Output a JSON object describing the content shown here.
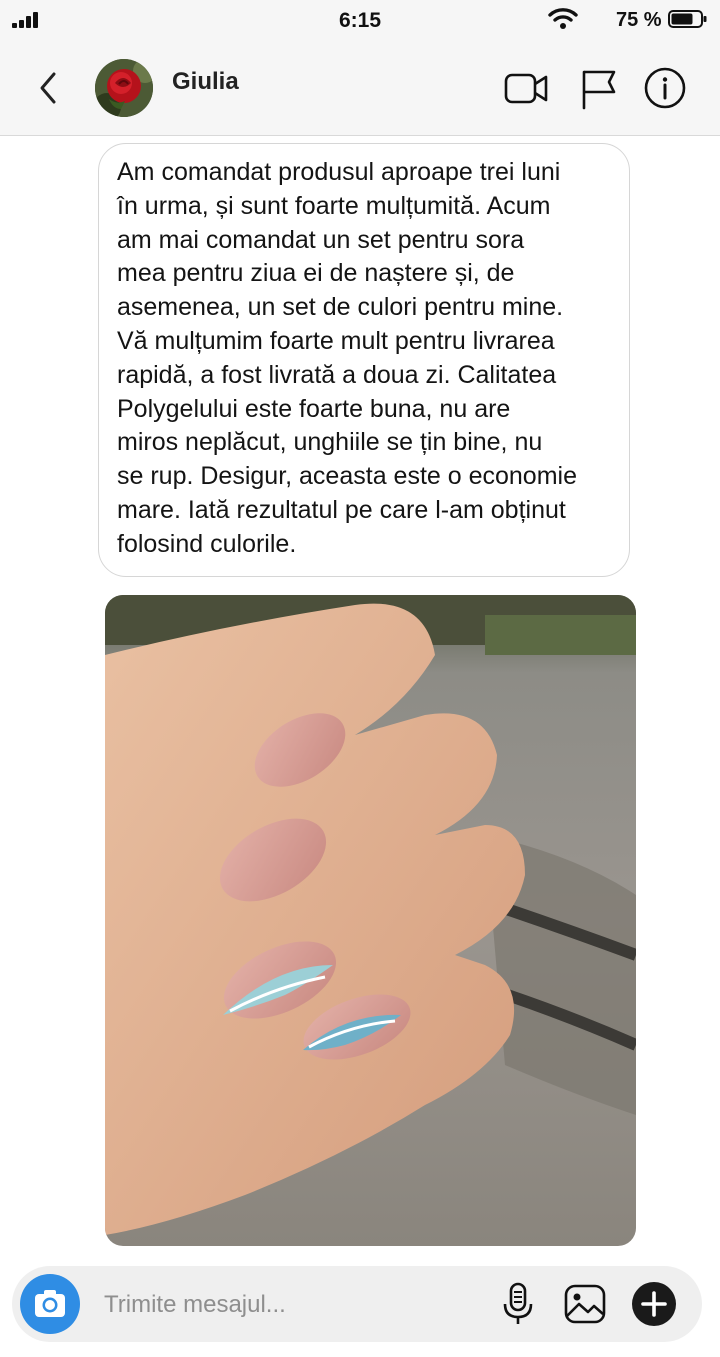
{
  "status_bar": {
    "time": "6:15",
    "battery_percent": "75 %",
    "battery_level": 0.75,
    "signal_bars": 4
  },
  "header": {
    "contact_name": "Giulia",
    "avatar_icon": "red-rose-avatar",
    "icons": [
      "chevron-left-icon",
      "video-call-icon",
      "flag-icon",
      "info-icon"
    ]
  },
  "message": {
    "lines": [
      "Am comandat produsul aproape trei luni",
      "în urma, și sunt foarte mulțumită. Acum",
      "am mai comandat un set pentru sora",
      "mea pentru ziua ei de naștere și, de",
      "asemenea, un set de culori pentru mine.",
      "Vă mulțumim foarte mult pentru livrarea",
      "rapidă, a fost livrată a doua zi. Calitatea",
      "Polygelului este foarte buna, nu are",
      "miros neplăcut, unghiile se țin bine, nu",
      "se rup. Desigur, aceasta este o economie",
      "mare. Iată rezultatul pe care l-am obținut",
      "folosind culorile."
    ]
  },
  "photo": {
    "subject": "hand-with-manicured-nails-photo"
  },
  "composer": {
    "placeholder": "Trimite mesajul...",
    "icons": [
      "camera-icon",
      "microphone-icon",
      "gallery-icon",
      "plus-icon"
    ]
  },
  "colors": {
    "accent": "#2f8de4",
    "bar_bg": "#f6f6f6",
    "composer_bg": "#efefef"
  }
}
